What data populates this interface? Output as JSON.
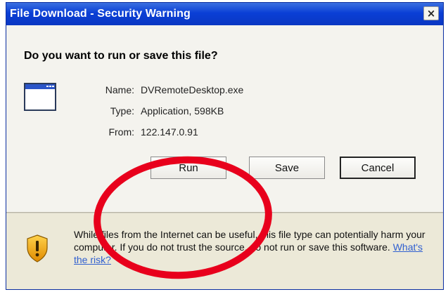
{
  "dialog": {
    "title": "File Download - Security Warning",
    "close_label": "×",
    "question": "Do you want to run or save this file?",
    "file": {
      "name_label": "Name:",
      "name_value": "DVRemoteDesktop.exe",
      "type_label": "Type:",
      "type_value": "Application, 598KB",
      "from_label": "From:",
      "from_value": "122.147.0.91"
    },
    "buttons": {
      "run": "Run",
      "save": "Save",
      "cancel": "Cancel"
    },
    "warning": {
      "text": "While files from the Internet can be useful, this file type can potentially harm your computer. If you do not trust the source, do not run or save this software.",
      "link": "What's the risk?"
    }
  },
  "colors": {
    "title_bar": "#0a3fd6",
    "dialog_bg": "#ece9d8",
    "annotation_circle": "#e8001c",
    "link": "#2f5fd0"
  },
  "icons": [
    "application-window-icon",
    "shield-warning-icon",
    "close-icon"
  ]
}
